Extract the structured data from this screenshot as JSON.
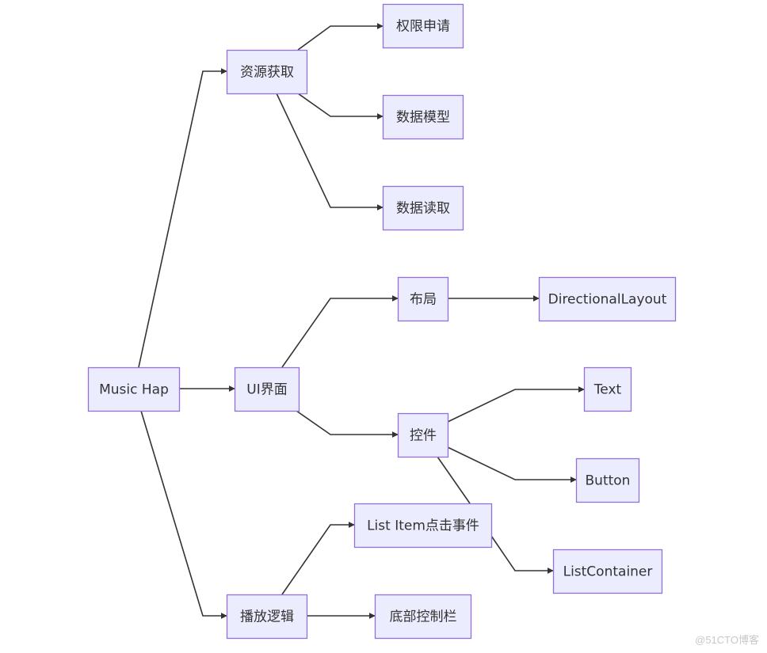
{
  "diagram": {
    "type": "flowchart-lr",
    "colors": {
      "node_fill": "#ececff",
      "node_border": "#9370db",
      "edge": "#333333",
      "text": "#333333"
    },
    "nodes": [
      {
        "id": "music_hap",
        "label": "Music Hap"
      },
      {
        "id": "resource",
        "label": "资源获取"
      },
      {
        "id": "ui",
        "label": "UI界面"
      },
      {
        "id": "playback",
        "label": "播放逻辑"
      },
      {
        "id": "permission",
        "label": "权限申请"
      },
      {
        "id": "data_model",
        "label": "数据模型"
      },
      {
        "id": "data_read",
        "label": "数据读取"
      },
      {
        "id": "layout",
        "label": "布局"
      },
      {
        "id": "controls",
        "label": "控件"
      },
      {
        "id": "list_item_click",
        "label": "List Item点击事件"
      },
      {
        "id": "bottom_bar",
        "label": "底部控制栏"
      },
      {
        "id": "directional_layout",
        "label": "DirectionalLayout"
      },
      {
        "id": "text",
        "label": "Text"
      },
      {
        "id": "button",
        "label": "Button"
      },
      {
        "id": "list_container",
        "label": "ListContainer"
      }
    ],
    "edges": [
      {
        "from": "music_hap",
        "to": "resource"
      },
      {
        "from": "music_hap",
        "to": "ui"
      },
      {
        "from": "music_hap",
        "to": "playback"
      },
      {
        "from": "resource",
        "to": "permission"
      },
      {
        "from": "resource",
        "to": "data_model"
      },
      {
        "from": "resource",
        "to": "data_read"
      },
      {
        "from": "ui",
        "to": "layout"
      },
      {
        "from": "ui",
        "to": "controls"
      },
      {
        "from": "layout",
        "to": "directional_layout"
      },
      {
        "from": "controls",
        "to": "text"
      },
      {
        "from": "controls",
        "to": "button"
      },
      {
        "from": "controls",
        "to": "list_container"
      },
      {
        "from": "playback",
        "to": "list_item_click"
      },
      {
        "from": "playback",
        "to": "bottom_bar"
      }
    ]
  },
  "watermark": "@51CTO博客"
}
